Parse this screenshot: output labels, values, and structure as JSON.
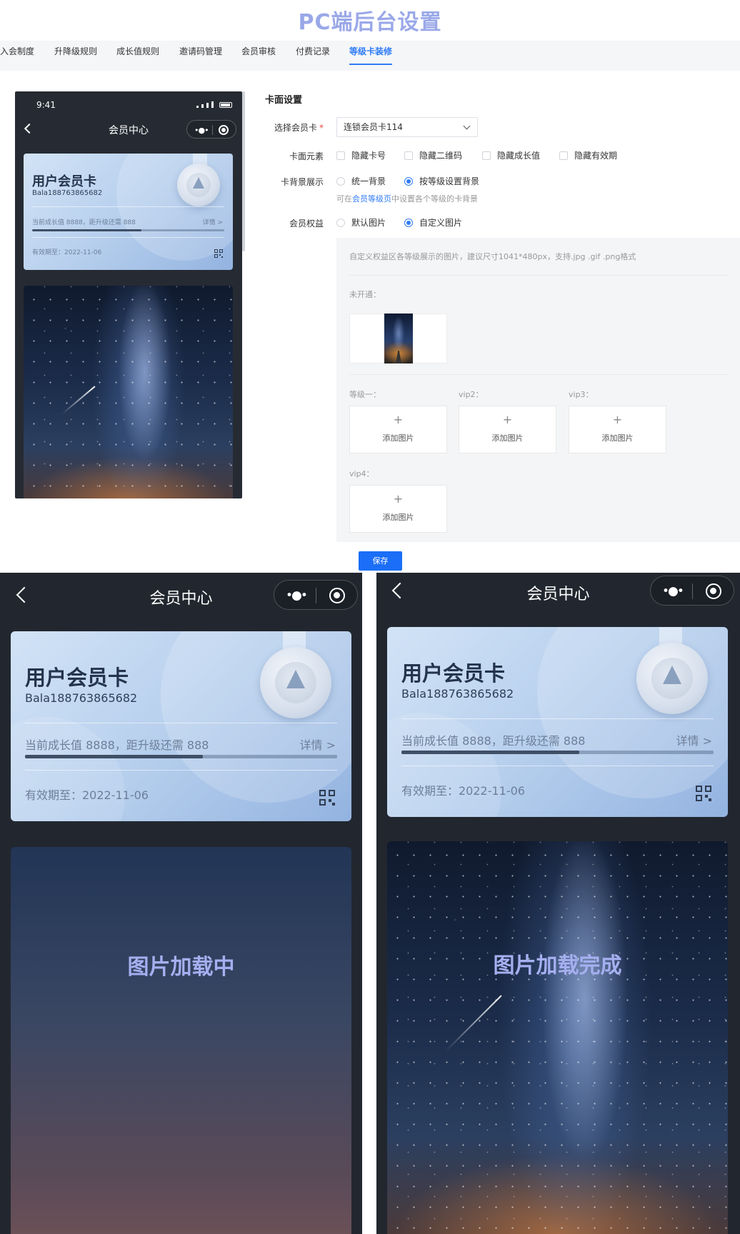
{
  "page_title": "PC端后台设置",
  "tabs": [
    {
      "label": "入会制度"
    },
    {
      "label": "升降级规则"
    },
    {
      "label": "成长值规则"
    },
    {
      "label": "邀请码管理"
    },
    {
      "label": "会员审核"
    },
    {
      "label": "付费记录"
    },
    {
      "label": "等级卡装修",
      "active": true
    }
  ],
  "preview": {
    "status_time": "9:41",
    "nav_title": "会员中心",
    "card": {
      "name": "用户会员卡",
      "number": "Bala188763865682",
      "growth_text": "当前成长值 8888，距升级还需 888",
      "detail_label": "详情 >",
      "progress": 0.57,
      "expiry": "有效期至：2022-11-06"
    }
  },
  "form": {
    "section_title": "卡面设置",
    "select_card_label": "选择会员卡",
    "select_card_value": "连锁会员卡114",
    "card_elements_label": "卡面元素",
    "card_elements_options": [
      "隐藏卡号",
      "隐藏二维码",
      "隐藏成长值",
      "隐藏有效期"
    ],
    "card_bg_label": "卡背景展示",
    "card_bg_options": [
      "统一背景",
      "按等级设置背景"
    ],
    "card_bg_selected": "按等级设置背景",
    "hint_prefix": "可在",
    "hint_link": "会员等级页",
    "hint_suffix": "中设置各个等级的卡背景",
    "rights_label": "会员权益",
    "rights_options": [
      "默认图片",
      "自定义图片"
    ],
    "rights_selected": "自定义图片",
    "panel_hint": "自定义权益区各等级展示的图片，建议尺寸1041*480px，支持.jpg .gif .png格式",
    "not_open_label": "未开通：",
    "levels": [
      {
        "label": "等级一：",
        "add_text": "添加图片"
      },
      {
        "label": "vip2：",
        "add_text": "添加图片"
      },
      {
        "label": "vip3：",
        "add_text": "添加图片"
      },
      {
        "label": "vip4：",
        "add_text": "添加图片"
      }
    ],
    "save_label": "保存"
  },
  "phone_loading": {
    "nav_title": "会员中心",
    "overlay": "图片加载中"
  },
  "phone_loaded": {
    "nav_title": "会员中心",
    "overlay": "图片加载完成"
  },
  "colors": {
    "accent": "#2f7cf6",
    "save_button": "#1a6ef7",
    "title": "#9aa8e8",
    "overlay_text": "#a5aff0",
    "phone_bg": "#22272f"
  }
}
